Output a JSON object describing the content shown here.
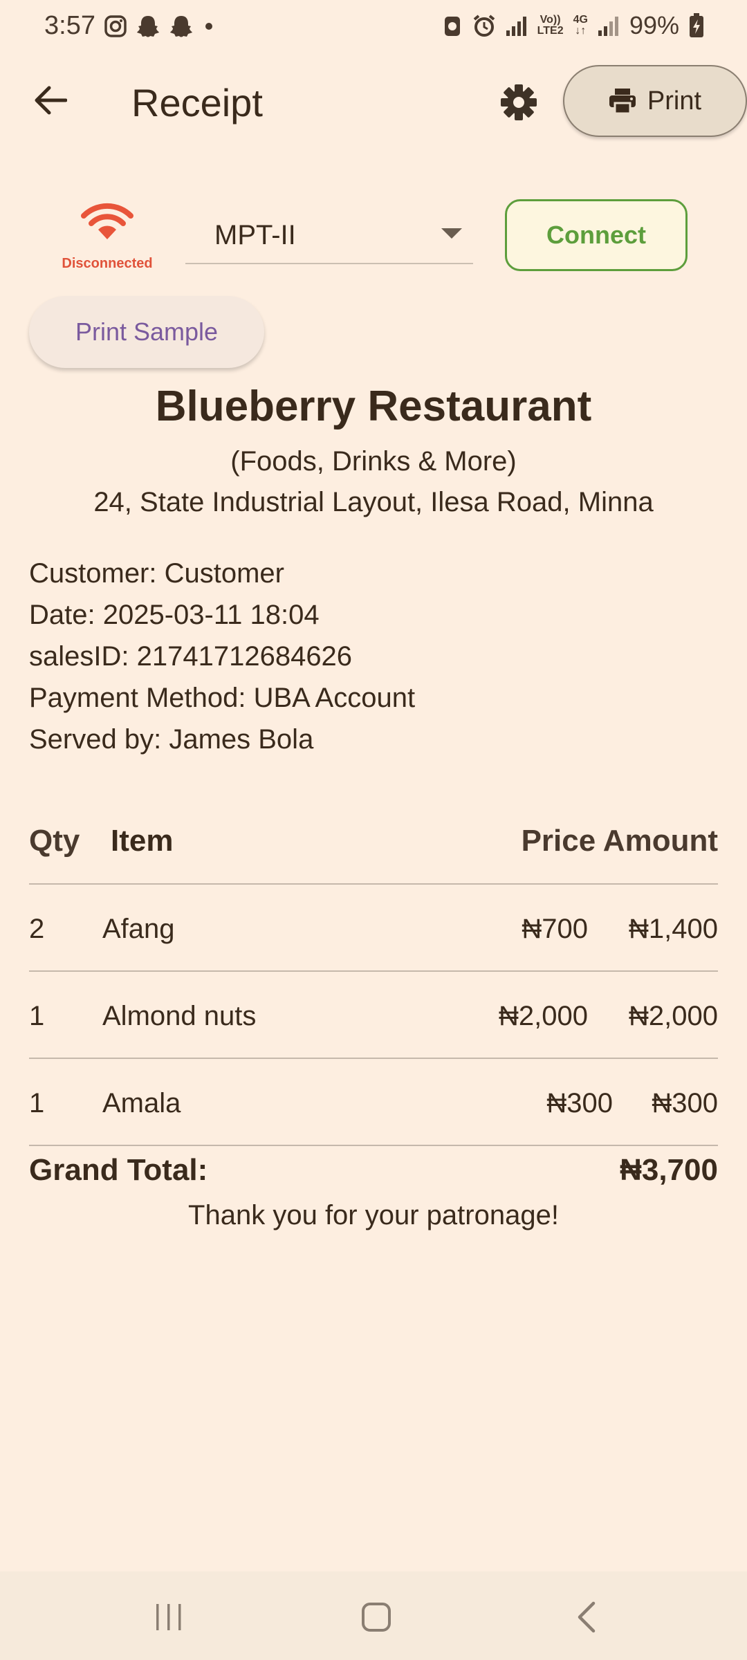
{
  "status_bar": {
    "time": "3:57",
    "battery_percent": "99%",
    "volte_top": "Vo))",
    "volte_bottom": "LTE2",
    "network_top": "4G",
    "network_bottom": "↓↑",
    "icons": [
      "instagram-icon",
      "snapchat-icon",
      "snapchat-icon",
      "dot-icon",
      "bug-icon",
      "alarm-icon",
      "signal-icon",
      "signal-icon",
      "battery-charging-icon"
    ]
  },
  "app_bar": {
    "title": "Receipt",
    "print_label": "Print",
    "icons": [
      "back-arrow-icon",
      "gear-icon",
      "printer-icon"
    ]
  },
  "printer": {
    "status": "Disconnected",
    "selected_device": "MPT-II",
    "connect_label": "Connect",
    "sample_label": "Print Sample",
    "status_color": "#e0523a",
    "connect_color": "#5d9e3c"
  },
  "receipt": {
    "store_name": "Blueberry Restaurant",
    "tagline": "(Foods, Drinks & More)",
    "address": "24, State Industrial Layout, Ilesa Road, Minna",
    "customer": "Customer: Customer",
    "date": "Date: 2025-03-11 18:04",
    "sales_id": "salesID: 21741712684626",
    "payment_method": "Payment Method: UBA Account",
    "served_by": "Served by: James  Bola",
    "headers": {
      "qty": "Qty",
      "item": "Item",
      "price_amount": "Price Amount"
    },
    "rows": [
      {
        "qty": "2",
        "item": "Afang",
        "price": "₦700",
        "amount": "₦1,400"
      },
      {
        "qty": "1",
        "item": "Almond nuts",
        "price": "₦2,000",
        "amount": "₦2,000"
      },
      {
        "qty": "1",
        "item": "Amala",
        "price": "₦300",
        "amount": "₦300"
      }
    ],
    "grand_total_label": "Grand Total:",
    "grand_total_value": "₦3,700",
    "thanks": "Thank you for your patronage!"
  },
  "nav_bar": {
    "icons": [
      "recent-apps-icon",
      "home-icon",
      "back-icon"
    ]
  }
}
